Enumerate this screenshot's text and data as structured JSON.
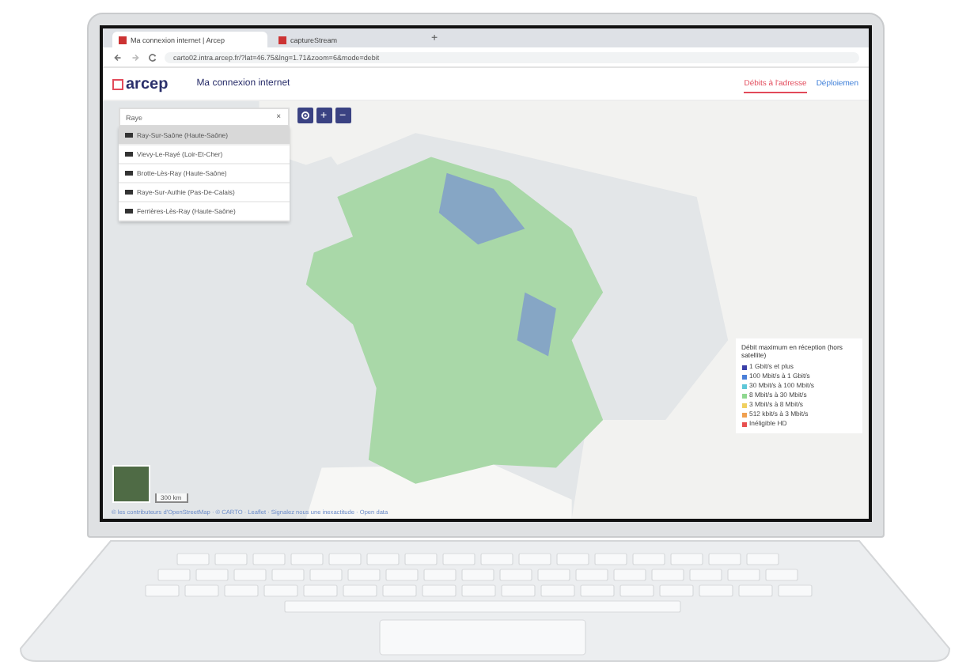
{
  "browser": {
    "tabs": [
      {
        "title": "Ma connexion internet | Arcep",
        "selected": true
      },
      {
        "title": "captureStream",
        "selected": false
      }
    ],
    "new_tab": "+",
    "address": "carto02.intra.arcep.fr/?lat=46.75&lng=1.71&zoom=6&mode=debit"
  },
  "header": {
    "logo": "arcep",
    "title": "Ma connexion internet",
    "nav": [
      {
        "label": "Débits à l'adresse",
        "selected": true
      },
      {
        "label": "Déploiemen",
        "selected": false
      }
    ]
  },
  "search": {
    "value": "Raye",
    "clear": "×",
    "results": [
      {
        "label": "Ray-Sur-Saône (Haute-Saône)",
        "selected": true
      },
      {
        "label": "Vievy-Le-Rayé (Loir-Et-Cher)",
        "selected": false
      },
      {
        "label": "Brotte-Lès-Ray (Haute-Saône)",
        "selected": false
      },
      {
        "label": "Raye-Sur-Authie (Pas-De-Calais)",
        "selected": false
      },
      {
        "label": "Ferrières-Lès-Ray (Haute-Saône)",
        "selected": false
      }
    ]
  },
  "map_controls": [
    {
      "kind": "locate"
    },
    {
      "kind": "text",
      "label": "+"
    },
    {
      "kind": "text",
      "label": "−"
    }
  ],
  "legend": {
    "title": "Débit maximum en réception (hors satellite)",
    "items": [
      {
        "label": "1 Gbit/s et plus",
        "color": "#3a3fa8"
      },
      {
        "label": "100 Mbit/s à 1 Gbit/s",
        "color": "#4a7fd8"
      },
      {
        "label": "30 Mbit/s à 100 Mbit/s",
        "color": "#5fc8d8"
      },
      {
        "label": "8 Mbit/s à 30 Mbit/s",
        "color": "#8fd890"
      },
      {
        "label": "3 Mbit/s à 8 Mbit/s",
        "color": "#f0d060"
      },
      {
        "label": "512 kbit/s à 3 Mbit/s",
        "color": "#f0a050"
      },
      {
        "label": "Inéligible HD",
        "color": "#e85050"
      }
    ]
  },
  "scale": "300 km",
  "attribution": "© les contributeurs d'OpenStreetMap · © CARTO · Leaflet · Signalez nous une inexactitude · Open data"
}
